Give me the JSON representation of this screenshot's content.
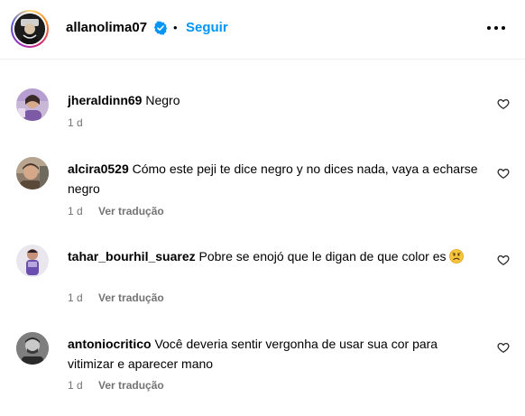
{
  "header": {
    "username": "allanolima07",
    "separator": "•",
    "follow_label": "Seguir",
    "verified_icon": "verified-badge-icon",
    "more_icon": "more-options-icon",
    "accent_color": "#0095f6"
  },
  "comments": [
    {
      "username": "jheraldinn69",
      "text": "Negro",
      "time": "1 d",
      "translate_label": "",
      "emoji": ""
    },
    {
      "username": "alcira0529",
      "text": "Cómo este peji te dice negro y no dices nada, vaya a echarse negro",
      "time": "1 d",
      "translate_label": "Ver tradução",
      "emoji": ""
    },
    {
      "username": "tahar_bourhil_suarez",
      "text": "Pobre se enojó que le digan de que color es",
      "time": "1 d",
      "translate_label": "Ver tradução",
      "emoji": "sad-face-emoji"
    },
    {
      "username": "antoniocritico",
      "text": "Você deveria sentir vergonha de usar sua cor para vitimizar e aparecer mano",
      "time": "1 d",
      "translate_label": "Ver tradução",
      "emoji": ""
    }
  ]
}
